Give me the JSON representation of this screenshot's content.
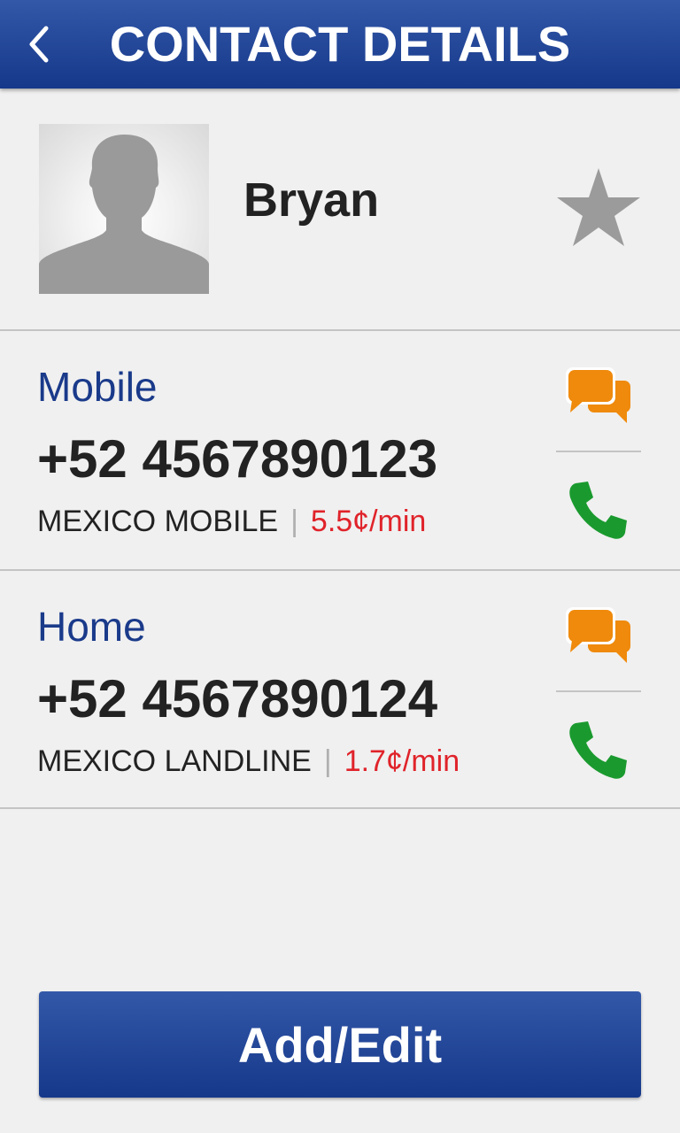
{
  "header": {
    "title": "CONTACT DETAILS"
  },
  "contact": {
    "name": "Bryan",
    "favorite": false
  },
  "phones": [
    {
      "type": "Mobile",
      "number": "+52 4567890123",
      "line_type": "MEXICO MOBILE",
      "separator": "|",
      "rate": "5.5¢/min"
    },
    {
      "type": "Home",
      "number": "+52 4567890124",
      "line_type": "MEXICO LANDLINE",
      "separator": "|",
      "rate": "1.7¢/min"
    }
  ],
  "footer": {
    "add_edit_label": "Add/Edit"
  },
  "colors": {
    "brand": "#1e4296",
    "label": "#1a3a8a",
    "rate": "#e0232a",
    "message": "#ef8a0c",
    "call": "#1a9a2e",
    "star": "#9b9b9b"
  }
}
